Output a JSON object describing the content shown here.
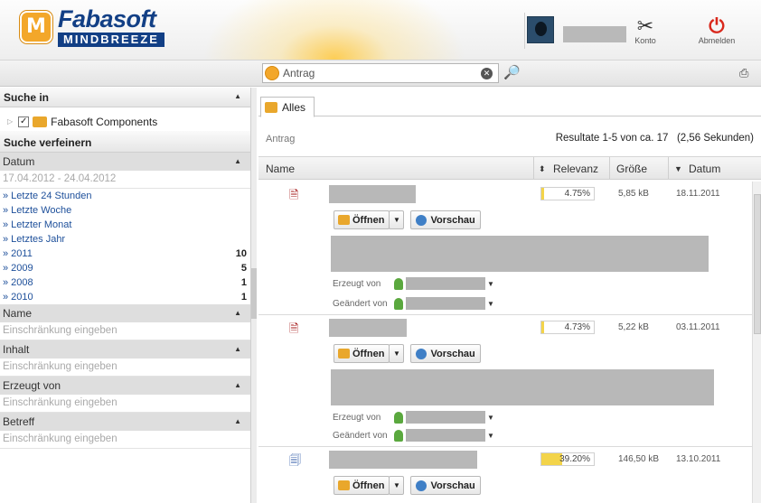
{
  "header": {
    "logo_name": "Fabasoft",
    "logo_sub": "MINDBREEZE",
    "logo_letter": "M",
    "konto_label": "Konto",
    "abmelden_label": "Abmelden"
  },
  "search": {
    "value": "Antrag",
    "clear_glyph": "✕"
  },
  "left": {
    "suche_in_title": "Suche in",
    "source_label": "Fabasoft Components",
    "source_checked": true,
    "refine_title": "Suche verfeinern",
    "datum_title": "Datum",
    "date_range": "17.04.2012 - 24.04.2012",
    "date_links": [
      {
        "label": "» Letzte 24 Stunden",
        "count": ""
      },
      {
        "label": "» Letzte Woche",
        "count": ""
      },
      {
        "label": "» Letzter Monat",
        "count": ""
      },
      {
        "label": "» Letztes Jahr",
        "count": ""
      },
      {
        "label": "» 2011",
        "count": "10"
      },
      {
        "label": "» 2009",
        "count": "5"
      },
      {
        "label": "» 2008",
        "count": "1"
      },
      {
        "label": "» 2010",
        "count": "1"
      }
    ],
    "filters": [
      {
        "title": "Name",
        "placeholder": "Einschränkung eingeben"
      },
      {
        "title": "Inhalt",
        "placeholder": "Einschränkung eingeben"
      },
      {
        "title": "Erzeugt von",
        "placeholder": "Einschränkung eingeben"
      },
      {
        "title": "Betreff",
        "placeholder": "Einschränkung eingeben"
      }
    ]
  },
  "main": {
    "tab_label": "Alles",
    "query_label": "Antrag",
    "result_count": "Resultate 1-5 von ca. 17   (2,56 Sekunden)",
    "columns": {
      "name": "Name",
      "relevanz": "Relevanz",
      "groesse": "Größe",
      "datum": "Datum"
    },
    "open_label": "Öffnen",
    "preview_label": "Vorschau",
    "created_by_label": "Erzeugt von",
    "modified_by_label": "Geändert von",
    "results": [
      {
        "type": "pdf",
        "relevance": "4.75%",
        "relevance_value": 4.75,
        "size": "5,85 kB",
        "date": "18.11.2011"
      },
      {
        "type": "pdf",
        "relevance": "4.73%",
        "relevance_value": 4.73,
        "size": "5,22 kB",
        "date": "03.11.2011"
      },
      {
        "type": "word",
        "relevance": "39.20%",
        "relevance_value": 39.2,
        "size": "146,50 kB",
        "date": "13.10.2011"
      }
    ]
  },
  "colors": {
    "brand_blue": "#123f85",
    "brand_orange": "#f3a72a",
    "link_blue": "#1d4f9a",
    "logout_red": "#d9281c"
  }
}
